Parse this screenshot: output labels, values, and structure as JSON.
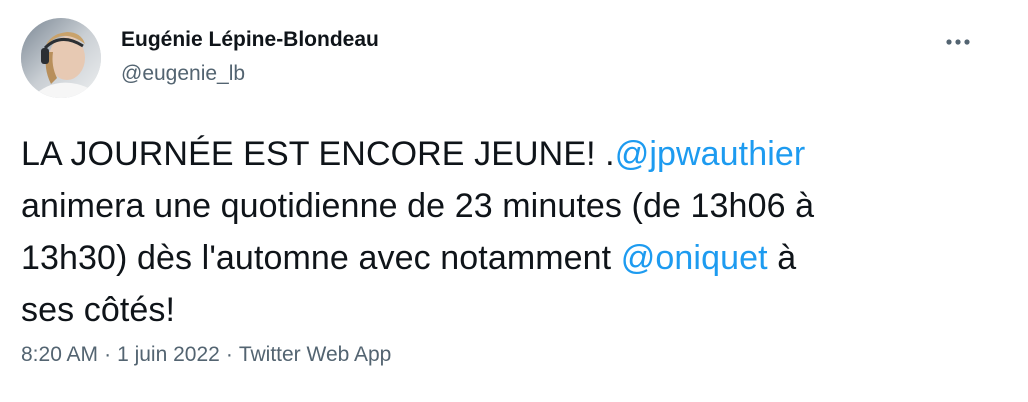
{
  "author": {
    "display_name": "Eugénie Lépine-Blondeau",
    "handle": "@eugenie_lb",
    "avatar_icon": "profile-photo"
  },
  "tweet": {
    "line1_text": "LA JOURNÉE EST ENCORE JEUNE! .",
    "mention1": "@jpwauthier",
    "line2_text": "animera une quotidienne de 23 minutes (de 13h06 à",
    "line3_text": "13h30) dès l'automne avec notamment ",
    "mention2": "@oniquet",
    "line3_after": " à",
    "line4_text": "ses côtés!"
  },
  "meta": {
    "time": "8:20 AM",
    "separator": "·",
    "date": "1 juin 2022",
    "source": "Twitter Web App"
  },
  "menu": {
    "icon": "more-icon"
  },
  "colors": {
    "link": "#1d9bf0",
    "secondary_text": "#536471",
    "primary_text": "#0f1419"
  }
}
